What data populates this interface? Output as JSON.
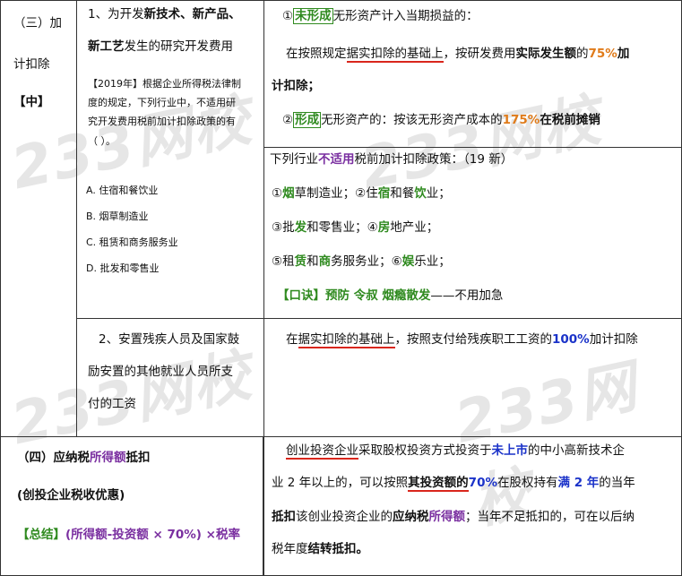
{
  "watermark": "233网校",
  "left": {
    "sec3_title_a": "（三）加",
    "sec3_title_b": "计扣除",
    "sec3_level": "【中】",
    "sec4_title_prefix": "（四）应纳税",
    "sec4_title_highlight": "所得额",
    "sec4_title_suffix": "抵扣",
    "sec4_sub": "(创投企业税收优惠)",
    "sec4_formula_tag": "【总结】",
    "sec4_formula": "(所得额-投资额 × 70%) ×税率"
  },
  "mid": {
    "item1_a": "1、为开发",
    "item1_b": "新技术、新产品、",
    "item1_c": "新工艺",
    "item1_d": "发生的研究开发费用",
    "question_lines": [
      "【2019年】根据企业所得税法律制",
      "度的规定，下列行业中，不适用研",
      "究开发费用税前加计扣除政策的有",
      "（          ）。"
    ],
    "options": [
      "A. 住宿和餐饮业",
      "B. 烟草制造业",
      "C. 租赁和商务服务业",
      "D. 批发和零售业"
    ],
    "item2_lines": [
      "2、安置残疾人员及国家鼓",
      "励安置的其他就业人员所支",
      "付的工资"
    ]
  },
  "right": {
    "r1_num": "①",
    "r1_tag": "未形成",
    "r1_text": "无形资产计入当期损益的：",
    "r1b_a": "在按照规定",
    "r1b_ul": "据实扣除的基础上",
    "r1b_b": "，按研发费用",
    "r1b_c": "实际发生额",
    "r1b_d": "的",
    "r1b_pct": "75%",
    "r1b_e": "加",
    "r1c": "计扣除；",
    "r2_num": "②",
    "r2_tag": "形成",
    "r2_text": "无形资产的：按该无形资产成本的",
    "r2_pct": "175%",
    "r2_b": "在",
    "r2_c": "税前摊销",
    "p_head_a": "下列行业",
    "p_head_b": "不适用",
    "p_head_c": "税前加计扣除政策：（19 新）",
    "p_l1": [
      [
        "①",
        ""
      ],
      [
        "烟",
        "g"
      ],
      [
        "草制造业；②住",
        ""
      ],
      [
        "宿",
        "g"
      ],
      [
        "和餐",
        ""
      ],
      [
        "饮",
        "g"
      ],
      [
        "业；",
        ""
      ]
    ],
    "p_l2": [
      [
        "③批",
        ""
      ],
      [
        "发",
        "g"
      ],
      [
        "和零售业；④",
        ""
      ],
      [
        "房",
        "g"
      ],
      [
        "地产业；",
        ""
      ]
    ],
    "p_l3": [
      [
        "⑤租",
        ""
      ],
      [
        "赁",
        "g"
      ],
      [
        "和",
        ""
      ],
      [
        "商",
        "g"
      ],
      [
        "务服务业；⑥",
        ""
      ],
      [
        "娱",
        "g"
      ],
      [
        "乐业；",
        ""
      ]
    ],
    "p_mnemonic": "【口诀】预防  令叔  烟瘾散发",
    "p_tail": "——不用加急",
    "c_a": "在",
    "c_ul": "据实扣除的基础上",
    "c_b": "，按照支付给残疾职工工资的",
    "c_pct": "100%",
    "c_c": "加计扣除",
    "d1_ul": "创业投资企业",
    "d1_a": "采取股权投资方式投资于",
    "d1_b": "未上市",
    "d1_c": "的中小高新技术企",
    "d2_a": "业 2 年以上的，可以按照",
    "d2_ul": "其投资额的",
    "d2_pct": "70%",
    "d2_b": "在股权持有",
    "d2_c": "满 2 年",
    "d2_d": "的当年",
    "d3_a": "抵扣",
    "d3_b": "该创业投资企业的",
    "d3_c": "应纳税",
    "d3_d": "所得额",
    "d3_e": "；当年不足抵扣的，可在以后纳",
    "d4_a": "税年度",
    "d4_b": "结转抵扣。"
  },
  "colors": {
    "green": "#2f8a1f",
    "orange": "#e07b1a",
    "blue": "#1b33c9",
    "purple": "#7a2fa0",
    "underline": "#d9261c"
  }
}
